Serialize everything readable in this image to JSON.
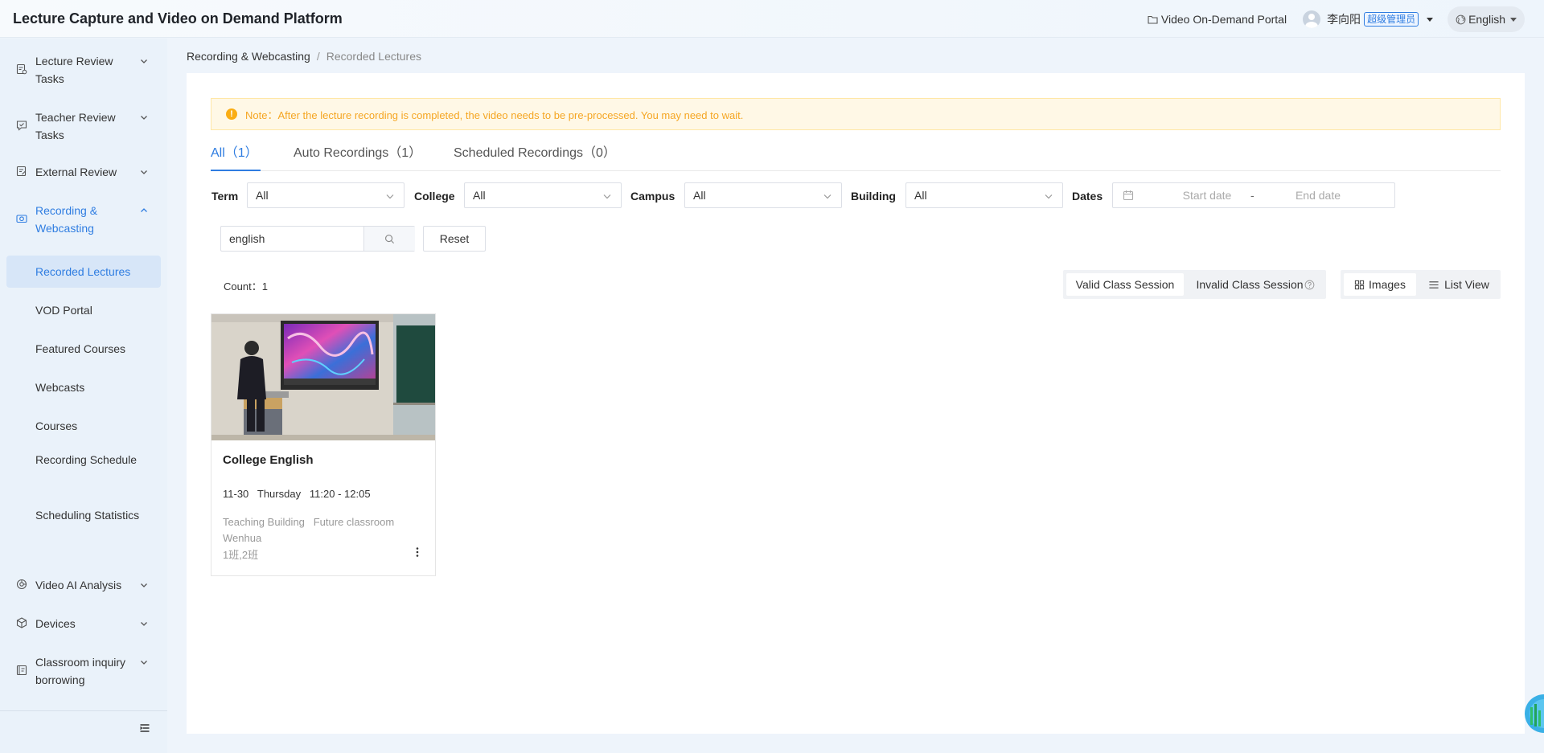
{
  "header": {
    "app_title": "Lecture Capture and Video on Demand Platform",
    "portal_link": "Video On-Demand Portal",
    "user_name": "李向阳",
    "user_role": "超级管理员",
    "language": "English"
  },
  "sidebar": {
    "items": [
      {
        "label": "Lecture Review Tasks",
        "icon": "checklist-icon"
      },
      {
        "label": "Teacher Review Tasks",
        "icon": "chat-check-icon"
      },
      {
        "label": "External Review",
        "icon": "document-edit-icon"
      },
      {
        "label": "Recording & Webcasting",
        "icon": "camera-icon"
      },
      {
        "label": "Video AI Analysis",
        "icon": "ai-analysis-icon"
      },
      {
        "label": "Devices",
        "icon": "cube-icon"
      },
      {
        "label": "Classroom inquiry borrowing",
        "icon": "classroom-icon"
      }
    ],
    "subitems": [
      {
        "label": "Recorded Lectures"
      },
      {
        "label": "VOD Portal"
      },
      {
        "label": "Featured Courses"
      },
      {
        "label": "Webcasts"
      },
      {
        "label": "Courses"
      },
      {
        "label": "Recording Schedule"
      },
      {
        "label": "Scheduling Statistics"
      }
    ]
  },
  "breadcrumb": {
    "parent": "Recording & Webcasting",
    "separator": "/",
    "current": "Recorded Lectures"
  },
  "notice": {
    "icon": "!",
    "text": "Note：After the lecture recording is completed, the video needs to be pre-processed. You may need to wait."
  },
  "tabs": [
    {
      "label": "All（1）"
    },
    {
      "label": "Auto Recordings（1）"
    },
    {
      "label": "Scheduled Recordings（0）"
    }
  ],
  "filters": {
    "term": {
      "label": "Term",
      "value": "All"
    },
    "college": {
      "label": "College",
      "value": "All"
    },
    "campus": {
      "label": "Campus",
      "value": "All"
    },
    "building": {
      "label": "Building",
      "value": "All"
    },
    "dates": {
      "label": "Dates",
      "start_placeholder": "Start date",
      "separator": "-",
      "end_placeholder": "End date"
    }
  },
  "search": {
    "value": "english",
    "reset_label": "Reset"
  },
  "count": {
    "label": "Count：",
    "value": "1"
  },
  "session_toggle": {
    "valid": "Valid Class Session",
    "invalid": "Invalid Class Session"
  },
  "view_toggle": {
    "images": "Images",
    "list": "List View"
  },
  "cards": [
    {
      "title": "College English",
      "time": "11-30   Thursday   11:20 - 12:05",
      "location": "Teaching Building   Future classroom Wenhua",
      "classes": "1班,2班"
    }
  ],
  "colors": {
    "accent": "#2f7de1",
    "warning": "#f5a623",
    "sidebar_bg": "#eaf2fa"
  }
}
